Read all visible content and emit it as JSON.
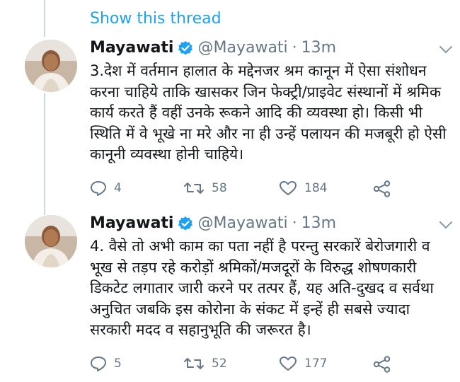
{
  "thread": {
    "show_thread_label": "Show this thread"
  },
  "colors": {
    "link_blue": "#1da1f2",
    "secondary_text": "#657786",
    "thread_line": "#ccd6dd"
  },
  "tweets": [
    {
      "name": "Mayawati",
      "handle": "@Mayawati",
      "separator": "·",
      "time": "13m",
      "text": "3.देश में वर्तमान हालात के मद्देनजर श्रम कानून में ऐसा संशोधन करना चाहिये ताकि खासकर जिन फेक्ट्री/प्राइवेट संस्थानों में श्रमिक कार्य करते हैं वहीं उनके रूकने आदि की व्यवस्था हो। किसी भी स्थिति में वे भूखे ना मरे और ना ही उन्हें पलायन की मजबूरी हो ऐसी कानूनी व्यवस्था होनी चाहिये।",
      "replies": "4",
      "retweets": "58",
      "likes": "184",
      "icons": {
        "reply": "reply-icon",
        "retweet": "retweet-icon",
        "like": "heart-icon",
        "share": "share-icon",
        "verified": "verified-badge-icon",
        "menu": "chevron-down-icon"
      }
    },
    {
      "name": "Mayawati",
      "handle": "@Mayawati",
      "separator": "·",
      "time": "13m",
      "text": "4. वैसे तो अभी काम का पता नहीं है परन्तु सरकारें बेरोजगारी व भूख से तड़प रहे करोड़ों श्रमिकों/मजदूरों के विरुद्ध शोषणकारी डिकटेट लगातार जारी करने पर तत्पर हैं, यह अति-दुखद व सर्वथा अनुचित जबकि इस कोरोना के संकट में इन्हें ही सबसे ज्यादा सरकारी मदद व सहानुभूति की जरूरत है।",
      "replies": "5",
      "retweets": "52",
      "likes": "177",
      "icons": {
        "reply": "reply-icon",
        "retweet": "retweet-icon",
        "like": "heart-icon",
        "share": "share-icon",
        "verified": "verified-badge-icon",
        "menu": "chevron-down-icon"
      }
    }
  ]
}
